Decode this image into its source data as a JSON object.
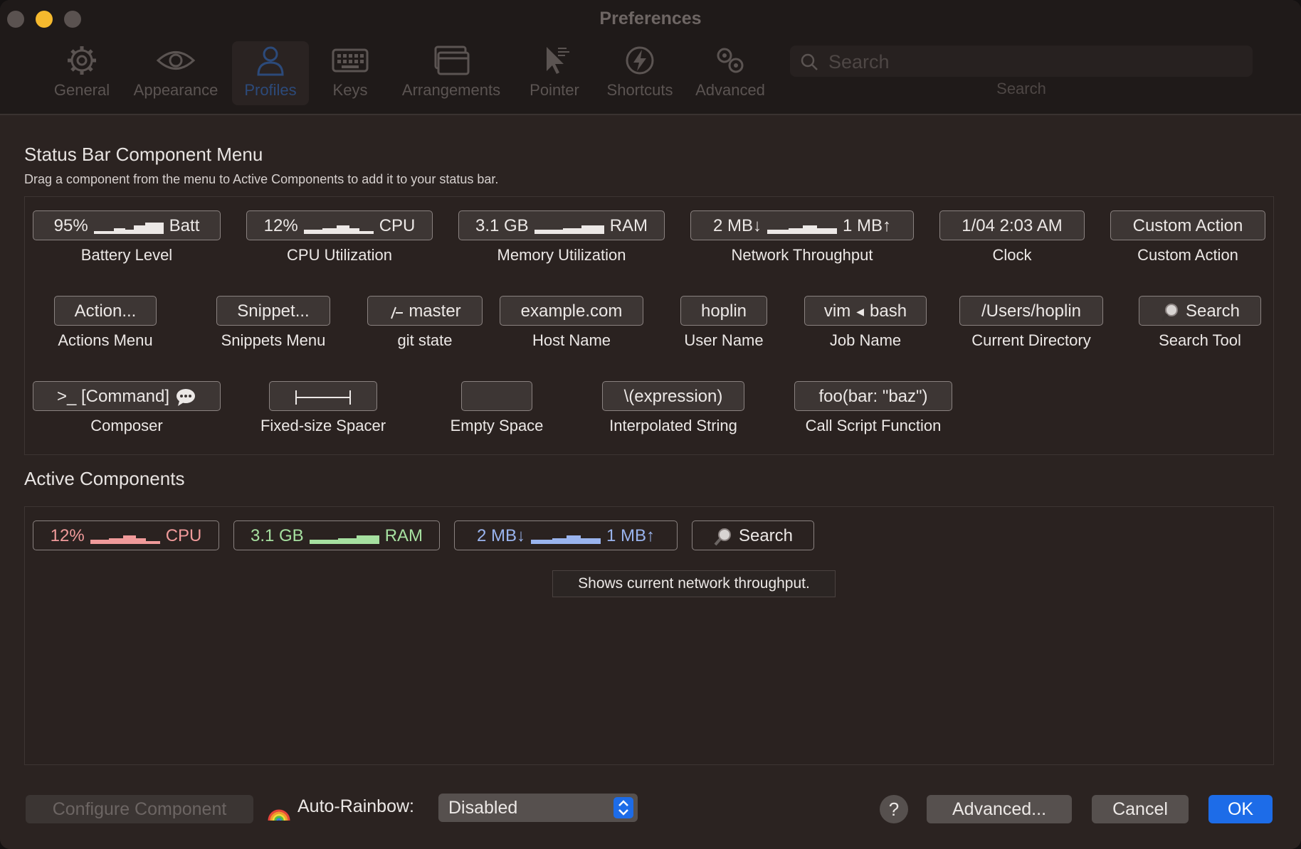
{
  "window": {
    "title": "Preferences"
  },
  "toolbar": {
    "tabs": [
      {
        "label": "General",
        "icon": "gear-icon"
      },
      {
        "label": "Appearance",
        "icon": "eye-icon"
      },
      {
        "label": "Profiles",
        "icon": "person-icon",
        "active": true
      },
      {
        "label": "Keys",
        "icon": "keyboard-icon"
      },
      {
        "label": "Arrangements",
        "icon": "windows-icon"
      },
      {
        "label": "Pointer",
        "icon": "pointer-icon"
      },
      {
        "label": "Shortcuts",
        "icon": "lightning-icon"
      },
      {
        "label": "Advanced",
        "icon": "gears-icon"
      }
    ],
    "search": {
      "placeholder": "Search",
      "caption": "Search"
    }
  },
  "menu": {
    "title": "Status Bar Component Menu",
    "subtitle": "Drag a component from the menu to Active Components to add it to your status bar.",
    "battery": {
      "left": "95%",
      "right": "Batt",
      "label": "Battery Level"
    },
    "cpu": {
      "left": "12%",
      "right": "CPU",
      "label": "CPU Utilization"
    },
    "memory": {
      "left": "3.1 GB",
      "right": "RAM",
      "label": "Memory Utilization"
    },
    "network": {
      "left": "2 MB↓",
      "right": "1 MB↑",
      "label": "Network Throughput"
    },
    "clock": {
      "text": "1/04 2:03 AM",
      "label": "Clock"
    },
    "custom_action": {
      "text": "Custom Action",
      "label": "Custom Action"
    },
    "actions": {
      "text": "Action...",
      "label": "Actions Menu"
    },
    "snippets": {
      "text": "Snippet...",
      "label": "Snippets Menu"
    },
    "git": {
      "text": "master",
      "label": "git state"
    },
    "host": {
      "text": "example.com",
      "label": "Host Name"
    },
    "user": {
      "text": "hoplin",
      "label": "User Name"
    },
    "job": {
      "left": "vim",
      "right": "bash",
      "label": "Job Name"
    },
    "directory": {
      "text": "/Users/hoplin",
      "label": "Current Directory"
    },
    "search_tool": {
      "text": "Search",
      "label": "Search Tool"
    },
    "composer": {
      "text": ">_ [Command]",
      "label": "Composer"
    },
    "spacer": {
      "label": "Fixed-size Spacer"
    },
    "empty": {
      "label": "Empty Space"
    },
    "interpolated": {
      "text": "\\(expression)",
      "label": "Interpolated String"
    },
    "script_function": {
      "text": "foo(bar: \"baz\")",
      "label": "Call Script Function"
    }
  },
  "active": {
    "title": "Active Components",
    "items": [
      {
        "left": "12%",
        "right": "CPU",
        "color": "#f09a9a"
      },
      {
        "left": "3.1 GB",
        "right": "RAM",
        "color": "#a6e0a0"
      },
      {
        "left": "2 MB↓",
        "right": "1 MB↑",
        "color": "#9ab4ee"
      },
      {
        "text": "Search",
        "color": "#ece8e6"
      }
    ],
    "tooltip": "Shows current network throughput."
  },
  "footer": {
    "configure": "Configure Component",
    "rainbow_label": "Auto-Rainbow:",
    "rainbow_value": "Disabled",
    "help": "?",
    "advanced": "Advanced...",
    "cancel": "Cancel",
    "ok": "OK"
  },
  "colors": {
    "accent": "#1d6ce8",
    "minimize": "#f5b92e"
  }
}
